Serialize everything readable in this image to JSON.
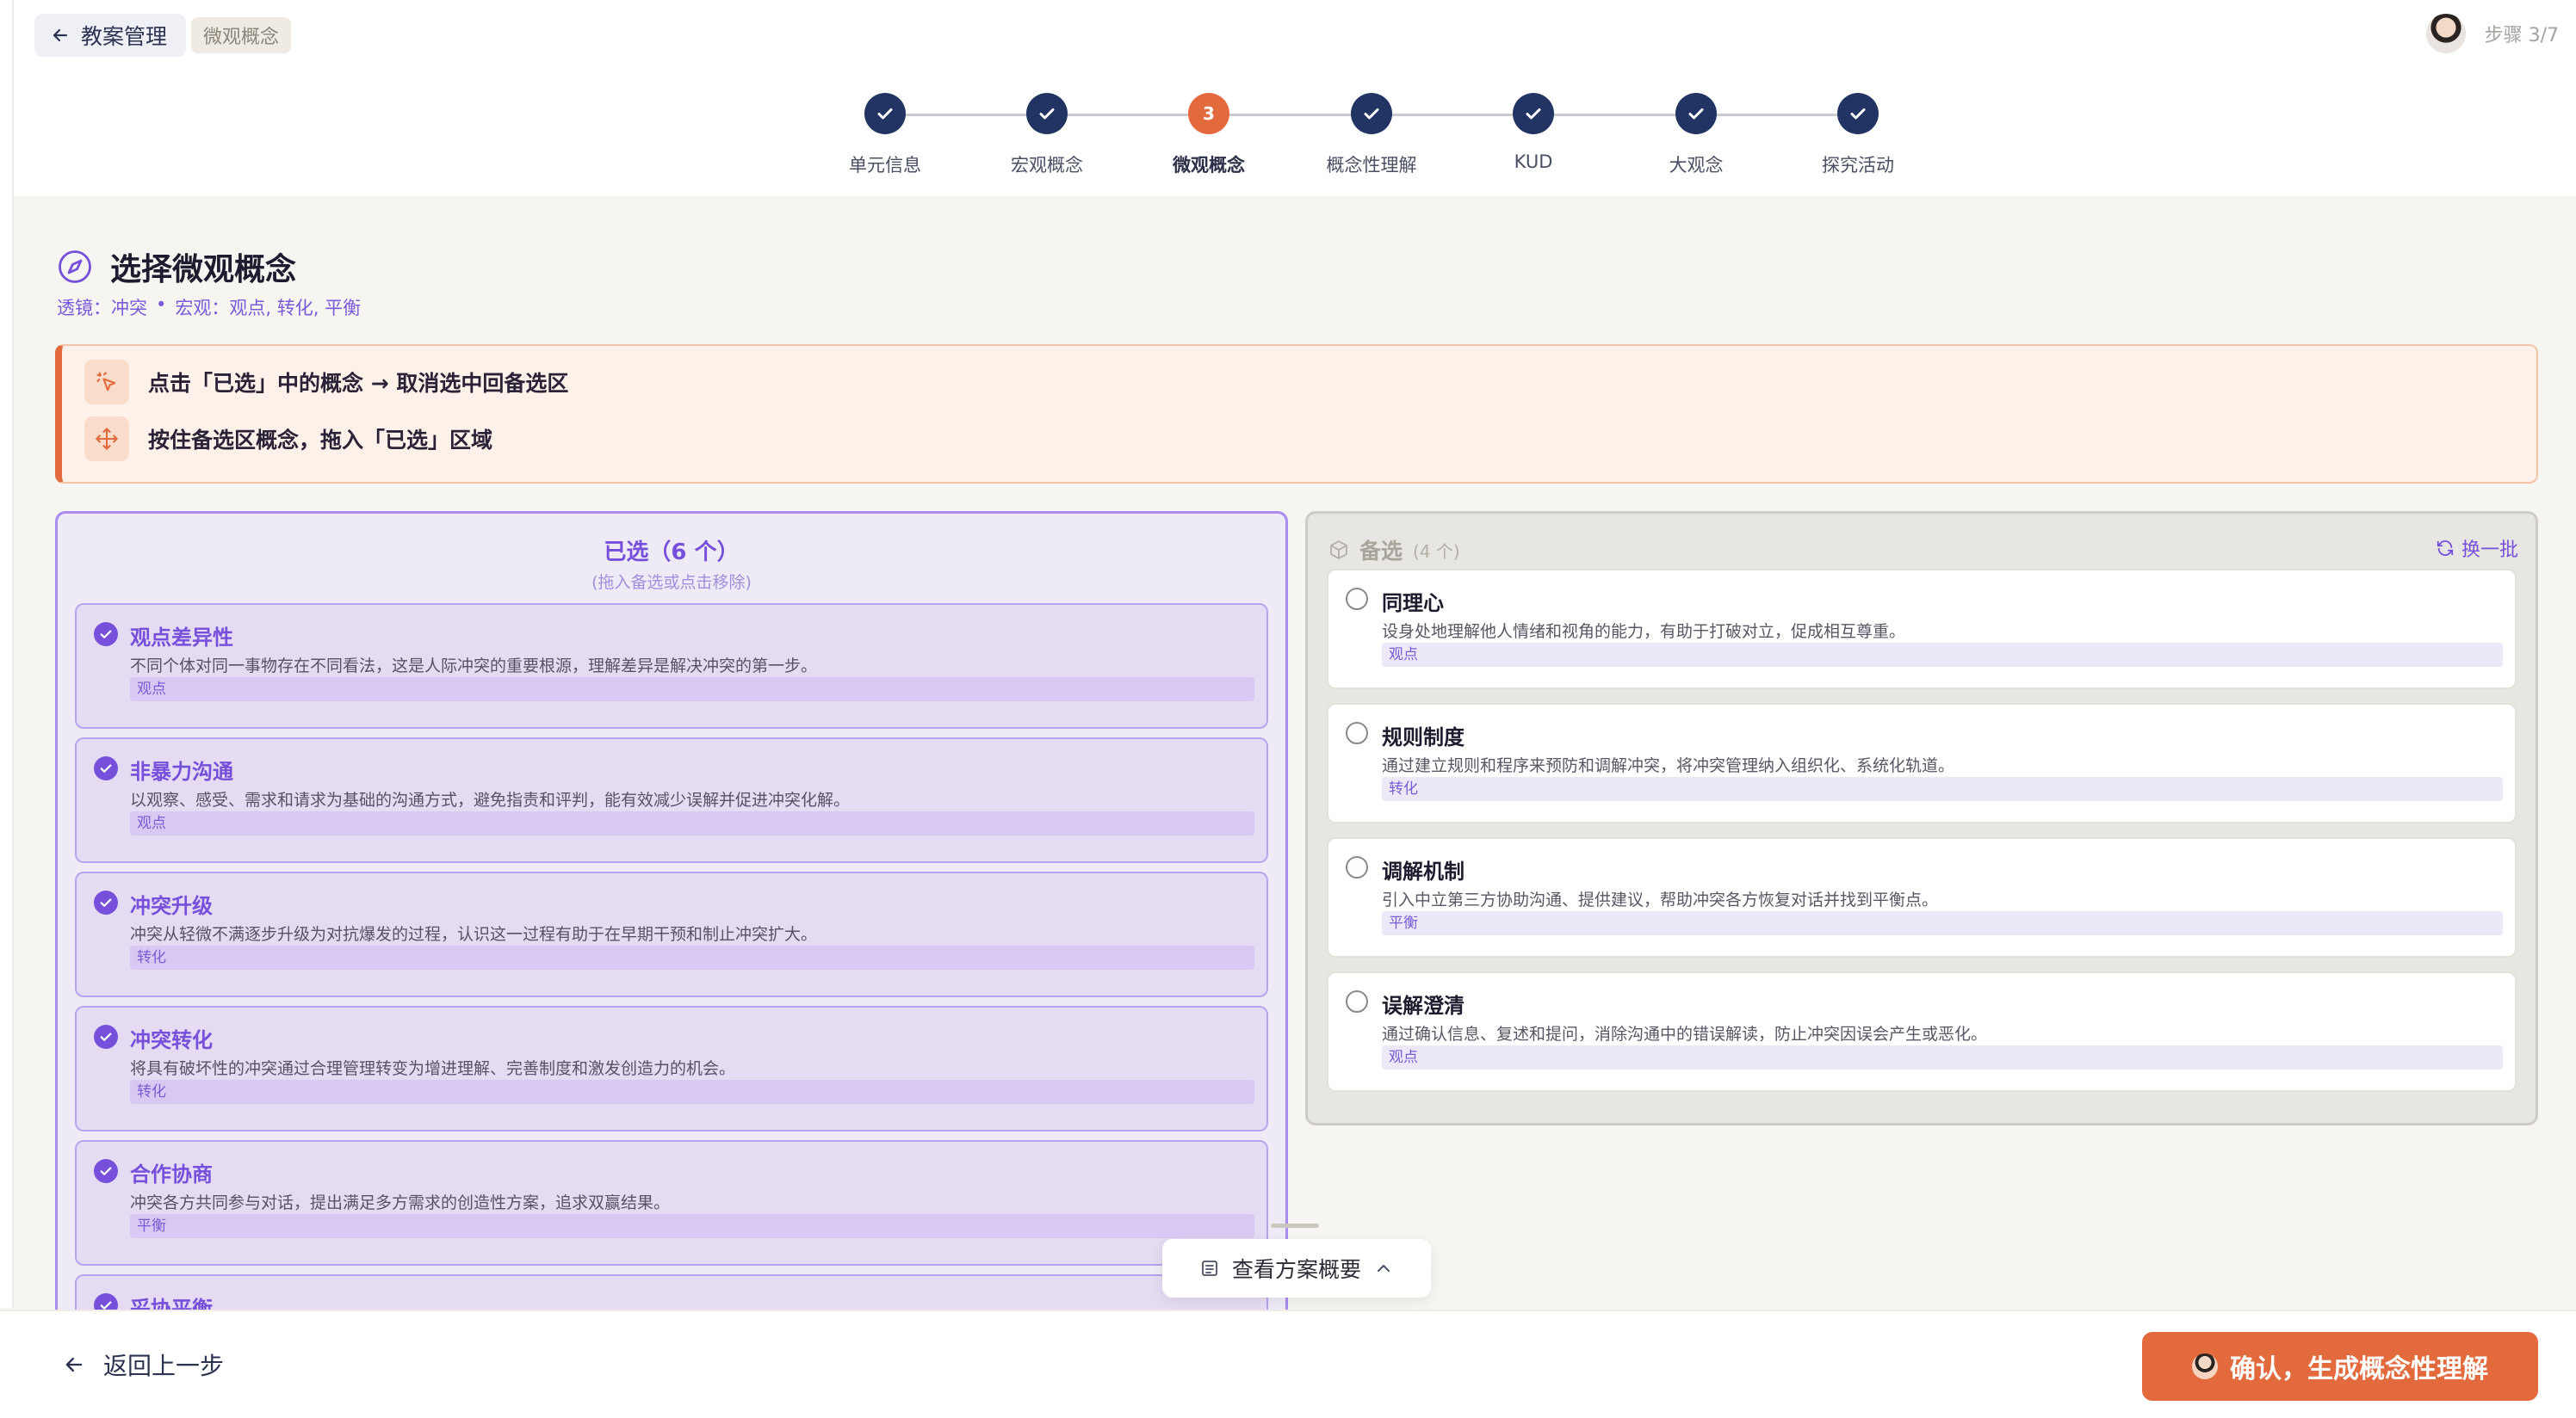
{
  "header": {
    "back_label": "教案管理",
    "crumb": "微观概念",
    "step_indicator": "步骤 3/7"
  },
  "stepper": {
    "steps": [
      {
        "label": "单元信息",
        "status": "done"
      },
      {
        "label": "宏观概念",
        "status": "done"
      },
      {
        "label": "微观概念",
        "status": "active",
        "number": "3"
      },
      {
        "label": "概念性理解",
        "status": "done"
      },
      {
        "label": "KUD",
        "status": "done"
      },
      {
        "label": "大观念",
        "status": "done"
      },
      {
        "label": "探究活动",
        "status": "done"
      }
    ]
  },
  "page": {
    "title": "选择微观概念",
    "subtitle_lens": "透镜：冲突",
    "subtitle_sep": "•",
    "subtitle_macro": "宏观：观点, 转化, 平衡"
  },
  "tips": {
    "tip1": "点击「已选」中的概念 → 取消选中回备选区",
    "tip2": "按住备选区概念，拖入「已选」区域"
  },
  "selected": {
    "title": "已选（6 个）",
    "hint": "(拖入备选或点击移除)",
    "items": [
      {
        "title": "观点差异性",
        "desc": "不同个体对同一事物存在不同看法，这是人际冲突的重要根源，理解差异是解决冲突的第一步。",
        "tag": "观点"
      },
      {
        "title": "非暴力沟通",
        "desc": "以观察、感受、需求和请求为基础的沟通方式，避免指责和评判，能有效减少误解并促进冲突化解。",
        "tag": "观点"
      },
      {
        "title": "冲突升级",
        "desc": "冲突从轻微不满逐步升级为对抗爆发的过程，认识这一过程有助于在早期干预和制止冲突扩大。",
        "tag": "转化"
      },
      {
        "title": "冲突转化",
        "desc": "将具有破坏性的冲突通过合理管理转变为增进理解、完善制度和激发创造力的机会。",
        "tag": "转化"
      },
      {
        "title": "合作协商",
        "desc": "冲突各方共同参与对话，提出满足多方需求的创造性方案，追求双赢结果。",
        "tag": "平衡"
      },
      {
        "title": "妥协平衡",
        "desc": "",
        "tag": ""
      }
    ]
  },
  "candidates": {
    "title": "备选",
    "count": "(4 个)",
    "refresh_label": "换一批",
    "items": [
      {
        "title": "同理心",
        "desc": "设身处地理解他人情绪和视角的能力，有助于打破对立，促成相互尊重。",
        "tag": "观点"
      },
      {
        "title": "规则制度",
        "desc": "通过建立规则和程序来预防和调解冲突，将冲突管理纳入组织化、系统化轨道。",
        "tag": "转化"
      },
      {
        "title": "调解机制",
        "desc": "引入中立第三方协助沟通、提供建议，帮助冲突各方恢复对话并找到平衡点。",
        "tag": "平衡"
      },
      {
        "title": "误解澄清",
        "desc": "通过确认信息、复述和提问，消除沟通中的错误解读，防止冲突因误会产生或恶化。",
        "tag": "观点"
      }
    ]
  },
  "overview": {
    "label": "查看方案概要"
  },
  "footer": {
    "prev_label": "返回上一步",
    "confirm_label": "确认，生成概念性理解"
  },
  "colors": {
    "accent": "#e36a3c",
    "navy": "#213463",
    "purple": "#7650db"
  }
}
